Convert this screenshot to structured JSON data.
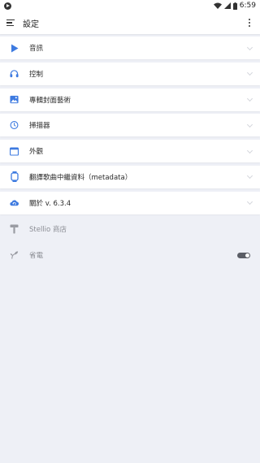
{
  "status_bar": {
    "time": "6:59"
  },
  "app_bar": {
    "title": "設定"
  },
  "menu": [
    {
      "label": "音訊",
      "icon": "play-icon"
    },
    {
      "label": "控制",
      "icon": "headphones-icon"
    },
    {
      "label": "專輯封面藝術",
      "icon": "image-icon"
    },
    {
      "label": "掃描器",
      "icon": "timer-icon"
    },
    {
      "label": "外觀",
      "icon": "window-icon"
    },
    {
      "label": "翻譯歌曲中繼資料（metadata）",
      "icon": "watch-icon"
    },
    {
      "label": "關於 v. 6.3.4",
      "icon": "cloud-refresh-icon"
    }
  ],
  "extra": [
    {
      "label": "Stellio 商店",
      "icon": "brush-icon"
    },
    {
      "label": "省電",
      "icon": "leaf-icon",
      "toggle": true
    }
  ],
  "colors": {
    "accent": "#3d7ae0",
    "background": "#eef0f6"
  }
}
